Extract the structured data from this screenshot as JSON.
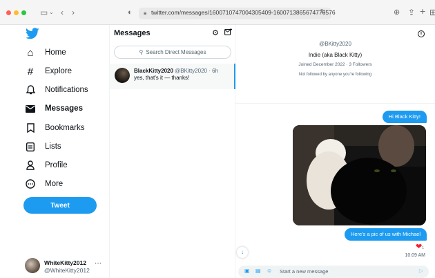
{
  "browser": {
    "url": "twitter.com/messages/1600710747004305409-1600713865674776576"
  },
  "nav": {
    "items": [
      {
        "label": "Home",
        "icon": "home-icon"
      },
      {
        "label": "Explore",
        "icon": "hashtag-icon"
      },
      {
        "label": "Notifications",
        "icon": "bell-icon"
      },
      {
        "label": "Messages",
        "icon": "envelope-icon"
      },
      {
        "label": "Bookmarks",
        "icon": "bookmark-icon"
      },
      {
        "label": "Lists",
        "icon": "list-icon"
      },
      {
        "label": "Profile",
        "icon": "person-icon"
      },
      {
        "label": "More",
        "icon": "more-circle-icon"
      }
    ],
    "tweet_button": "Tweet",
    "account": {
      "name": "WhiteKitty2012",
      "handle": "@WhiteKitty2012"
    }
  },
  "messages": {
    "title": "Messages",
    "search_placeholder": "Search Direct Messages",
    "conversation": {
      "name": "BlackKitty2020",
      "handle_time": "@BKitty2020 · 6h",
      "preview": "yes, that's it — thanks!"
    }
  },
  "conversation": {
    "profile": {
      "handle": "@BKitty2020",
      "name": "Indie (aka Black Kitty)",
      "joined": "Joined December 2022 · 3 Followers",
      "follow_note": "Not followed by anyone you're following"
    },
    "messages": [
      {
        "text": "Hi Black Kitty!"
      },
      {
        "text": "Here's a pic of us with Michael"
      }
    ],
    "reaction_count": "1",
    "time": "10:09 AM",
    "composer_placeholder": "Start a new message"
  },
  "colors": {
    "accent": "#1d9bf0",
    "heart": "#f4212e"
  }
}
